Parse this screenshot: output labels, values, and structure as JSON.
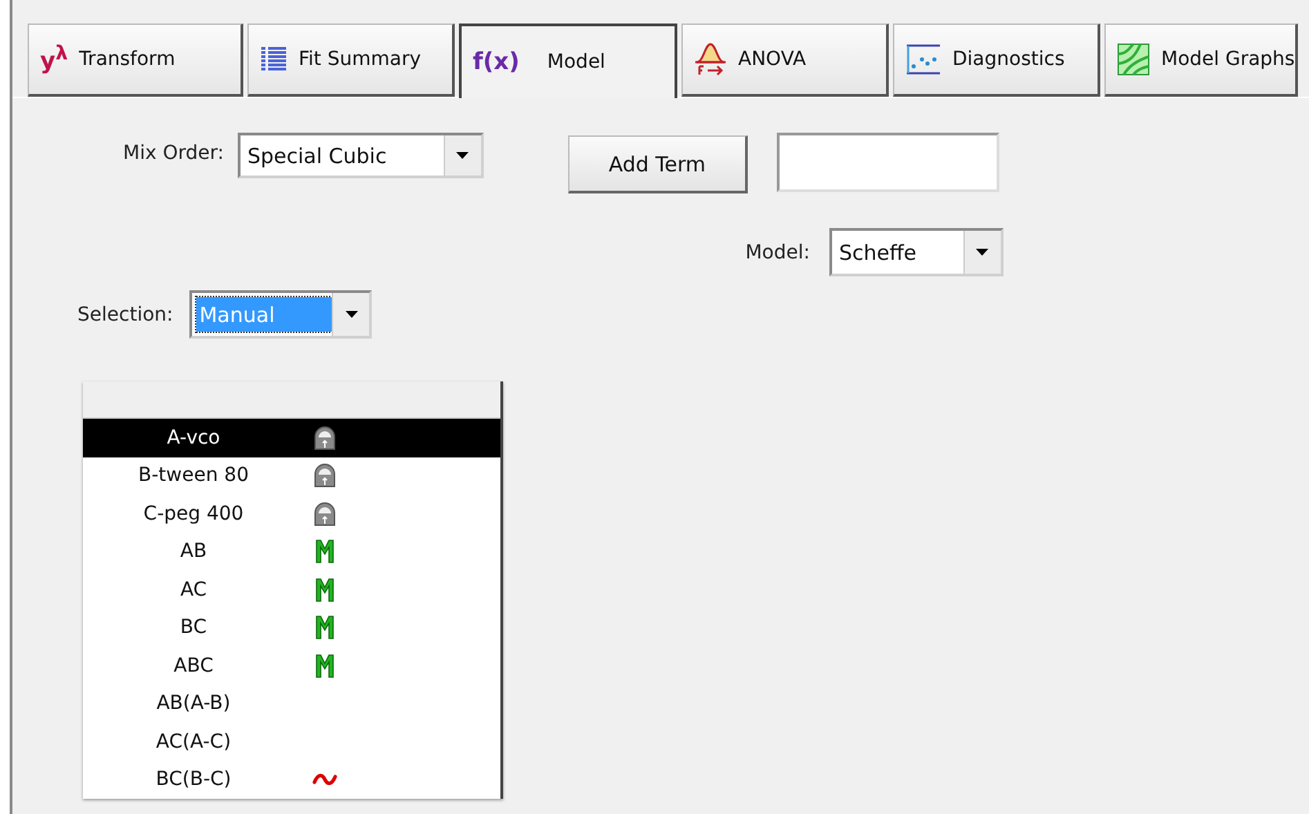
{
  "tabs": [
    {
      "label": "Transform",
      "kind": "power",
      "icon_text": "y$^{λ}$",
      "selected": false
    },
    {
      "label": "Fit Summary",
      "kind": "list",
      "selected": false
    },
    {
      "label": "Model",
      "kind": "function",
      "icon_text": "f(x)",
      "selected": true
    },
    {
      "label": "ANOVA",
      "kind": "distribution",
      "selected": false
    },
    {
      "label": "Diagnostics",
      "kind": "scatter",
      "selected": false
    },
    {
      "label": "Model Graphs",
      "kind": "contour",
      "selected": false
    }
  ],
  "mix_order": {
    "label": "Mix Order:",
    "value": "Special Cubic"
  },
  "add_term": {
    "button": "Add Term"
  },
  "model": {
    "label": "Model:",
    "value": "Scheffe"
  },
  "selection": {
    "label": "Selection:",
    "value": "Manual"
  },
  "terms": [
    {
      "name": "A-vco",
      "kind": "locked",
      "selected": true
    },
    {
      "name": "B-tween 80",
      "kind": "locked",
      "selected": false
    },
    {
      "name": "C-peg 400",
      "kind": "locked",
      "selected": false
    },
    {
      "name": "AB",
      "kind": "model",
      "selected": false
    },
    {
      "name": "AC",
      "kind": "model",
      "selected": false
    },
    {
      "name": "BC",
      "kind": "model",
      "selected": false
    },
    {
      "name": "ABC",
      "kind": "model",
      "selected": false
    },
    {
      "name": "AB(A-B)",
      "kind": "plain",
      "selected": false
    },
    {
      "name": "AC(A-C)",
      "kind": "plain",
      "selected": false
    },
    {
      "name": "BC(B-C)",
      "kind": "aliased",
      "selected": false
    }
  ]
}
